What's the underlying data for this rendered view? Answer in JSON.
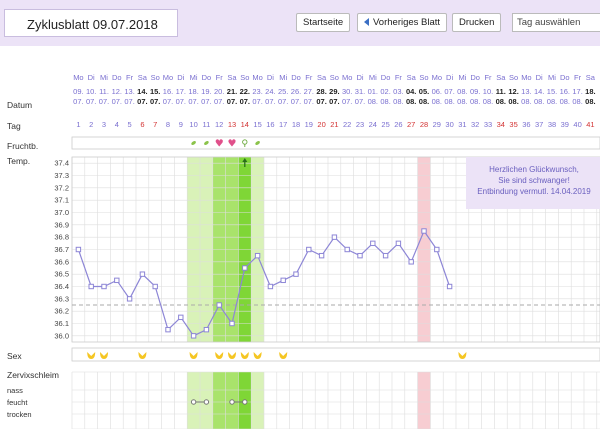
{
  "header": {
    "title": "Zyklusblatt 09.07.2018",
    "home_button": "Startseite",
    "prev_button": "Vorheriges Blatt",
    "print_button": "Drucken",
    "day_select_placeholder": "Tag auswählen"
  },
  "labels": {
    "datum": "Datum",
    "tag": "Tag",
    "fruchtb": "Fruchtb.",
    "temp": "Temp.",
    "sex": "Sex",
    "zervix": "Zervixschleim",
    "nass": "nass",
    "feucht": "feucht",
    "trocken": "trocken"
  },
  "congrats": {
    "line1": "Herzlichen Glückwunsch,",
    "line2": "Sie sind schwanger!",
    "line3": "Entbindung vermutl. 14.04.2019"
  },
  "weekdays": [
    "Mo",
    "Di",
    "Mi",
    "Do",
    "Fr",
    "Sa",
    "So",
    "Mo",
    "Di",
    "Mi",
    "Do",
    "Fr",
    "Sa",
    "So",
    "Mo",
    "Di",
    "Mi",
    "Do",
    "Fr",
    "Sa",
    "So",
    "Mo",
    "Di",
    "Mi",
    "Do",
    "Fr",
    "Sa",
    "So",
    "Mo",
    "Di",
    "Mi",
    "Do",
    "Fr",
    "Sa",
    "So",
    "Mo",
    "Di",
    "Mi",
    "Do",
    "Fr",
    "Sa",
    "So"
  ],
  "dates_day": [
    "09.",
    "10.",
    "11.",
    "12.",
    "13.",
    "14.",
    "15.",
    "16.",
    "17.",
    "18.",
    "19.",
    "20.",
    "21.",
    "22.",
    "23.",
    "24.",
    "25.",
    "26.",
    "27.",
    "28.",
    "29.",
    "30.",
    "31.",
    "01.",
    "02.",
    "03.",
    "04.",
    "05.",
    "06.",
    "07.",
    "08.",
    "09.",
    "10.",
    "11.",
    "12.",
    "13.",
    "14.",
    "15.",
    "16.",
    "17.",
    "18.",
    "19."
  ],
  "dates_month": [
    "07.",
    "07.",
    "07.",
    "07.",
    "07.",
    "07.",
    "07.",
    "07.",
    "07.",
    "07.",
    "07.",
    "07.",
    "07.",
    "07.",
    "07.",
    "07.",
    "07.",
    "07.",
    "07.",
    "07.",
    "07.",
    "07.",
    "07.",
    "08.",
    "08.",
    "08.",
    "08.",
    "08.",
    "08.",
    "08.",
    "08.",
    "08.",
    "08.",
    "08.",
    "08.",
    "08.",
    "08.",
    "08.",
    "08.",
    "08.",
    "08.",
    "08."
  ],
  "cycle_days": [
    "1",
    "2",
    "3",
    "4",
    "5",
    "6",
    "7",
    "8",
    "9",
    "10",
    "11",
    "12",
    "13",
    "14",
    "15",
    "16",
    "17",
    "18",
    "19",
    "20",
    "21",
    "22",
    "23",
    "24",
    "25",
    "26",
    "27",
    "28",
    "29",
    "30",
    "31",
    "32",
    "33",
    "34",
    "35",
    "36",
    "37",
    "38",
    "39",
    "40",
    "41",
    "42"
  ],
  "temp_axis": [
    "37.4",
    "37.3",
    "37.2",
    "37.1",
    "37.0",
    "36.9",
    "36.8",
    "36.7",
    "36.6",
    "36.5",
    "36.4",
    "36.3",
    "36.2",
    "36.1",
    "36.0"
  ],
  "temperatures": [
    36.7,
    36.4,
    36.4,
    36.45,
    36.3,
    36.5,
    36.4,
    36.05,
    36.15,
    36.0,
    36.05,
    36.25,
    36.1,
    36.55,
    36.65,
    36.4,
    36.45,
    36.5,
    36.7,
    36.65,
    36.8,
    36.7,
    36.65,
    36.75,
    36.65,
    36.75,
    36.6,
    36.85,
    36.7,
    36.4
  ],
  "cover_line": 36.25,
  "fertile_days": [
    10,
    11,
    12,
    13,
    14,
    15
  ],
  "peak_days": [
    12,
    13,
    14
  ],
  "ovulation_day": 14,
  "period_day": 28,
  "fertility_marks": [
    {
      "day": 10,
      "icon": "leaf-icon"
    },
    {
      "day": 11,
      "icon": "leaf-icon"
    },
    {
      "day": 12,
      "icon": "heart-icon"
    },
    {
      "day": 13,
      "icon": "heart-icon"
    },
    {
      "day": 14,
      "icon": "female-symbol-icon"
    },
    {
      "day": 15,
      "icon": "leaf-icon"
    }
  ],
  "sex_days": [
    2,
    3,
    6,
    10,
    12,
    13,
    14,
    15,
    17,
    31
  ],
  "mucus_lines": [
    [
      10,
      11
    ],
    [
      13,
      14
    ]
  ],
  "colors": {
    "purple": "#7a6fd0",
    "line": "#8d86d6",
    "fertile": "#d9f2b8",
    "peak": "#a9e36b",
    "ovu": "#7fd636",
    "period": "#f7cdd2",
    "red": "#d33333",
    "heart": "#e0508a",
    "sex": "#f5c623"
  }
}
